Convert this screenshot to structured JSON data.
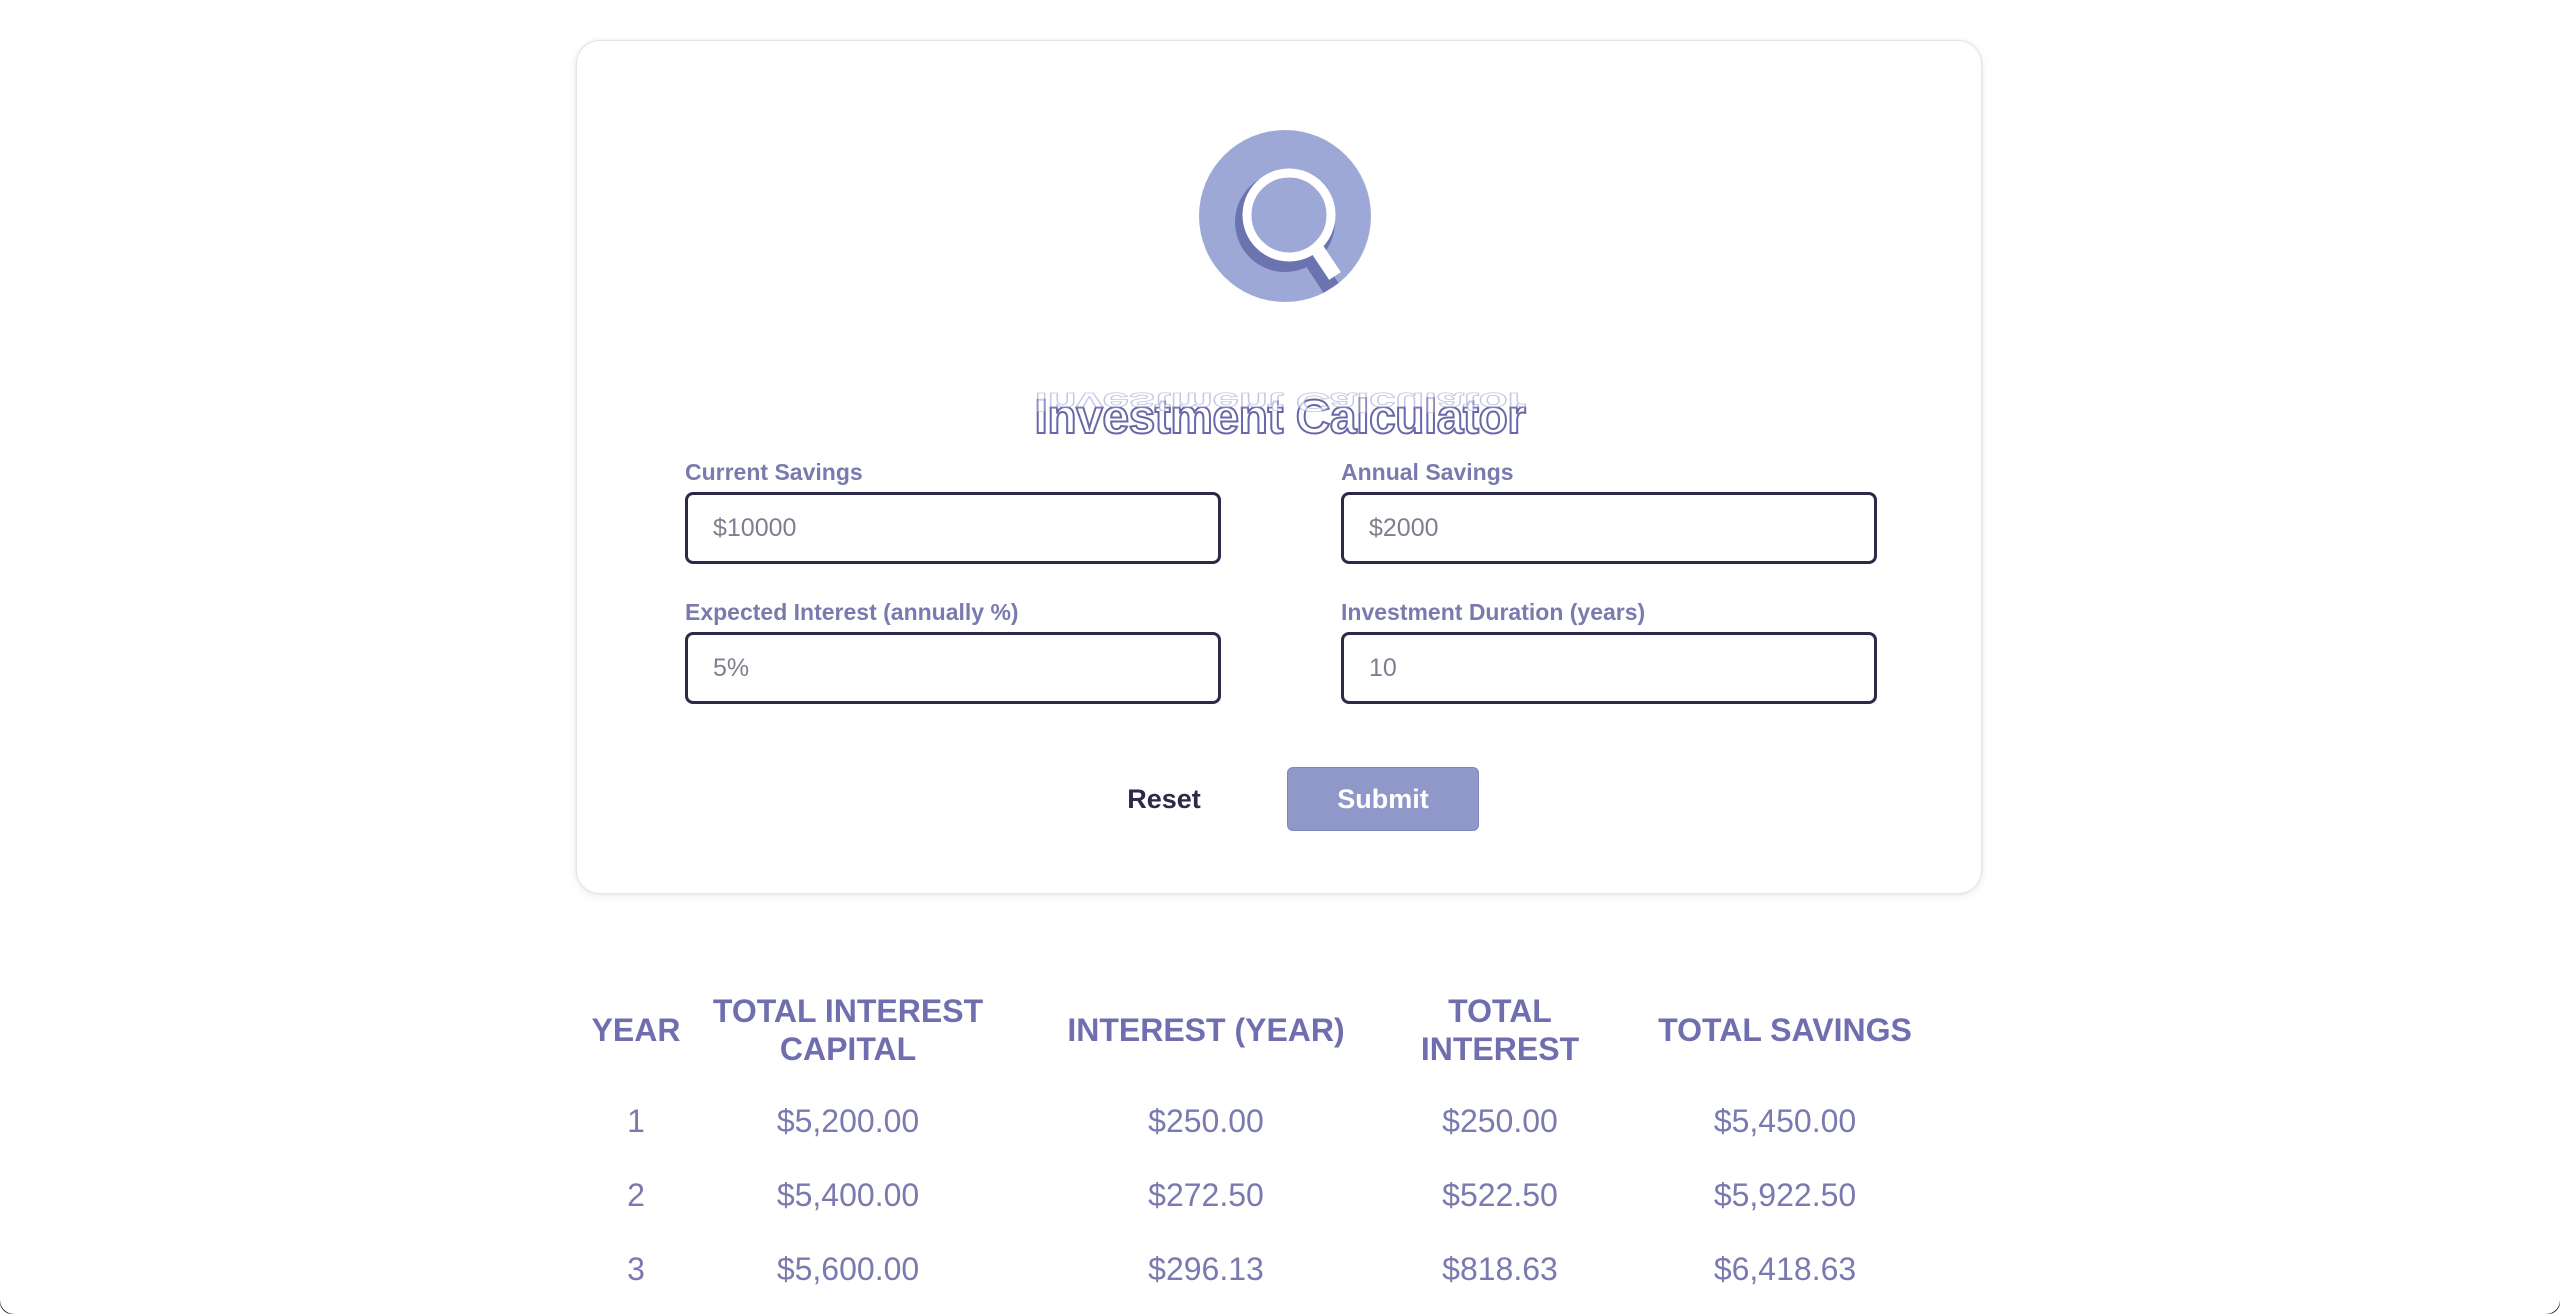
{
  "app": {
    "title": "Investment Calculator",
    "logo_icon": "magnifying-glass-icon"
  },
  "form": {
    "fields": [
      {
        "label": "Current Savings",
        "placeholder": "$10000",
        "value": ""
      },
      {
        "label": "Annual Savings",
        "placeholder": "$2000",
        "value": ""
      },
      {
        "label": "Expected Interest (annually %)",
        "placeholder": "5%",
        "value": ""
      },
      {
        "label": "Investment Duration (years)",
        "placeholder": "10",
        "value": ""
      }
    ],
    "reset_label": "Reset",
    "submit_label": "Submit"
  },
  "table": {
    "headers": [
      "Year",
      "Total Interest Capital",
      "Interest (Year)",
      "Total Interest",
      "Total Savings"
    ],
    "rows": [
      [
        "1",
        "$5,200.00",
        "$250.00",
        "$250.00",
        "$5,450.00"
      ],
      [
        "2",
        "$5,400.00",
        "$272.50",
        "$522.50",
        "$5,922.50"
      ],
      [
        "3",
        "$5,600.00",
        "$296.13",
        "$818.63",
        "$6,418.63"
      ]
    ]
  },
  "colors": {
    "accent": "#8f98c9",
    "logo_bg": "#9ea8d6",
    "text_muted": "#7a7aae",
    "border_dark": "#2b2a4a"
  }
}
